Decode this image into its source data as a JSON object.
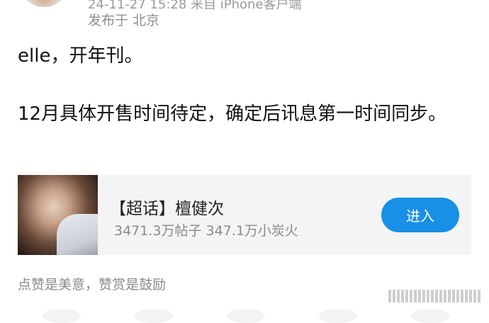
{
  "post": {
    "meta_top": "24-11-27 15:28  来自 iPhone客户端",
    "location": "发布于 北京",
    "text_line_1": "elle，开年刊。",
    "text_line_2": "12月具体开售时间待定，确定后讯息第一时间同步。"
  },
  "supertopic_card": {
    "title": "【超话】檀健次",
    "stats": "3471.3万帖子 347.1万小炭火",
    "enter_button": "进入"
  },
  "footer": {
    "reward_text": "点赞是美意，赞赏是鼓励"
  }
}
